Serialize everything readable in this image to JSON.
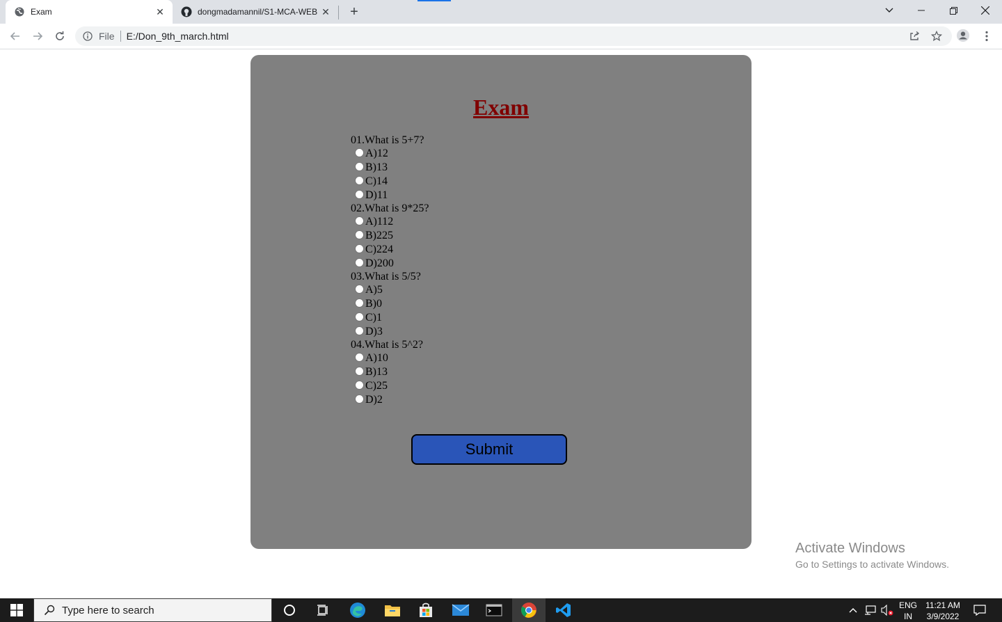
{
  "browser": {
    "tabs": [
      {
        "title": "Exam",
        "active": true
      },
      {
        "title": "dongmadamannil/S1-MCA-WEB",
        "active": false
      }
    ],
    "address": {
      "scheme_label": "File",
      "url": "E:/Don_9th_march.html"
    }
  },
  "page": {
    "title": "Exam",
    "questions": [
      {
        "text": "01.What is 5+7?",
        "options": [
          "A)12",
          "B)13",
          "C)14",
          "D)11"
        ]
      },
      {
        "text": "02.What is 9*25?",
        "options": [
          "A)112",
          "B)225",
          "C)224",
          "D)200"
        ]
      },
      {
        "text": "03.What is 5/5?",
        "options": [
          "A)5",
          "B)0",
          "C)1",
          "D)3"
        ]
      },
      {
        "text": "04.What is 5^2?",
        "options": [
          "A)10",
          "B)13",
          "C)25",
          "D)2"
        ]
      }
    ],
    "submit_label": "Submit"
  },
  "watermark": {
    "title": "Activate Windows",
    "subtitle": "Go to Settings to activate Windows."
  },
  "taskbar": {
    "search_placeholder": "Type here to search",
    "language_line1": "ENG",
    "language_line2": "IN",
    "time": "11:21 AM",
    "date": "3/9/2022"
  }
}
